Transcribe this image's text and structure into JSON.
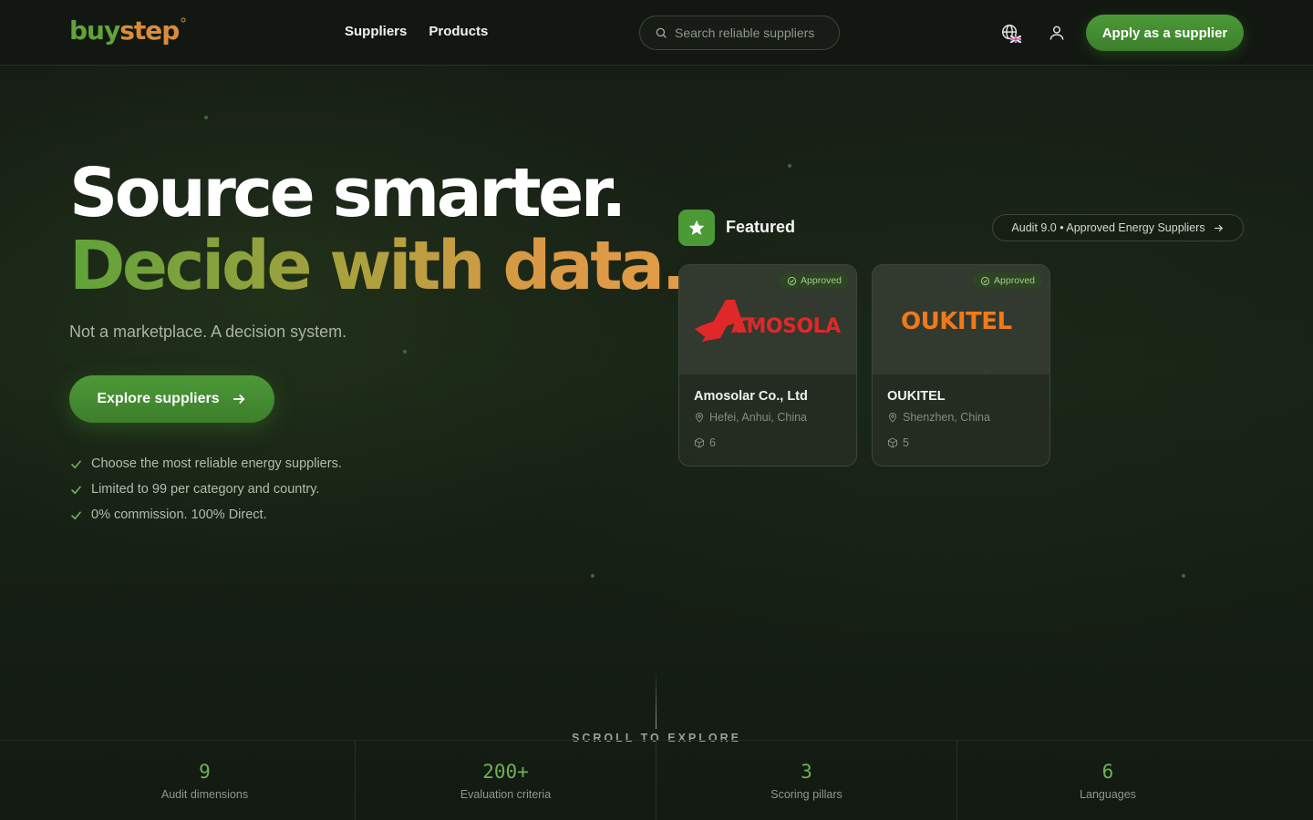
{
  "header": {
    "logo_text": "buystep",
    "nav": [
      "Suppliers",
      "Products"
    ],
    "search_placeholder": "Search reliable suppliers",
    "language_icon": "globe-icon",
    "language_flag": "uk-flag",
    "account_icon": "user-icon",
    "apply_label": "Apply as a supplier"
  },
  "hero": {
    "title_line1": "Source smarter.",
    "title_line2": "Decide with data.",
    "tagline": "Not a marketplace. A decision system.",
    "cta_label": "Explore suppliers",
    "checks": [
      "Choose the most reliable energy suppliers.",
      "Limited to 99 per category and country.",
      "0% commission. 100% Direct."
    ]
  },
  "featured": {
    "title": "Featured",
    "audit_link": "Audit 9.0 • Approved Energy Suppliers",
    "cards": [
      {
        "logo_text": "AMOSOLAR",
        "badge": "Approved",
        "name": "Amosolar Co., Ltd",
        "location": "Hefei, Anhui, China",
        "products": "6"
      },
      {
        "logo_text": "OUKITEL",
        "badge": "Approved",
        "name": "OUKITEL",
        "location": "Shenzhen, China",
        "products": "5"
      }
    ]
  },
  "scroll_label": "SCROLL TO EXPLORE",
  "stats": [
    {
      "value": "9",
      "label": "Audit dimensions"
    },
    {
      "value": "200+",
      "label": "Evaluation criteria"
    },
    {
      "value": "3",
      "label": "Scoring pillars"
    },
    {
      "value": "6",
      "label": "Languages"
    }
  ],
  "colors": {
    "accent_green": "#4b9a36",
    "gradient_gold": "#d99a45",
    "background": "#141a12"
  }
}
